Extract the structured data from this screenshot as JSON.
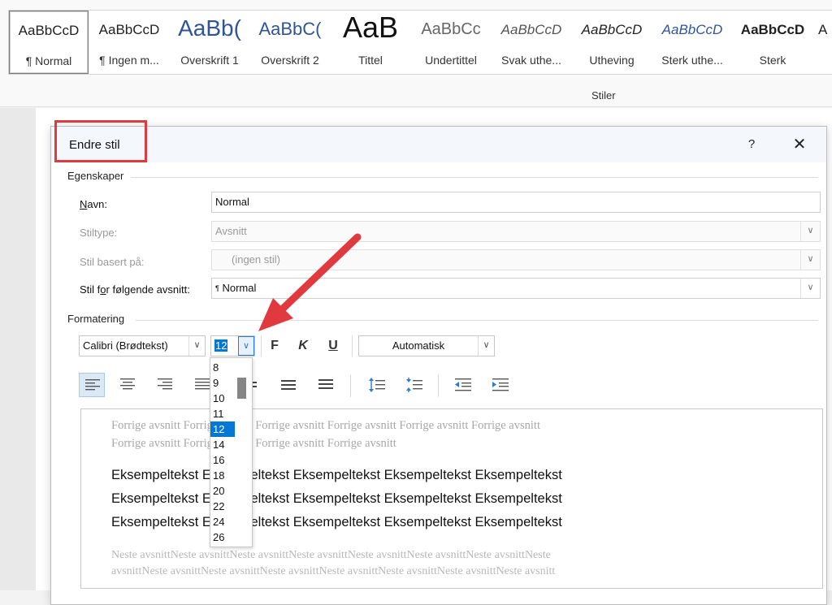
{
  "ribbon": {
    "styles": [
      {
        "preview": "AaBbCcD",
        "name": "¶ Normal",
        "selected": true
      },
      {
        "preview": "AaBbCcD",
        "name": "¶ Ingen m...",
        "selected": false
      },
      {
        "preview": "AaBb(",
        "name": "Overskrift 1",
        "selected": false
      },
      {
        "preview": "AaBbC(",
        "name": "Overskrift 2",
        "selected": false
      },
      {
        "preview": "AaB",
        "name": "Tittel",
        "selected": false
      },
      {
        "preview": "AaBbCc",
        "name": "Undertittel",
        "selected": false
      },
      {
        "preview": "AaBbCcD",
        "name": "Svak uthe...",
        "selected": false
      },
      {
        "preview": "AaBbCcD",
        "name": "Utheving",
        "selected": false
      },
      {
        "preview": "AaBbCcD",
        "name": "Sterk uthe...",
        "selected": false
      },
      {
        "preview": "AaBbCcD",
        "name": "Sterk",
        "selected": false
      },
      {
        "preview": "A",
        "name": "",
        "selected": false
      }
    ],
    "group_label": "Stiler"
  },
  "dialog": {
    "title": "Endre stil",
    "help": "?",
    "close": "✕",
    "properties": {
      "section": "Egenskaper",
      "name_label": "Navn:",
      "name_value": "Normal",
      "type_label": "Stiltype:",
      "type_value": "Avsnitt",
      "based_label": "Stil basert på:",
      "based_value": "(ingen stil)",
      "next_label": "Stil for følgende avsnitt:",
      "next_value": "Normal",
      "next_marker": "¶"
    },
    "formatting": {
      "section": "Formatering",
      "font": "Calibri (Brødtekst)",
      "size": "12",
      "bold": "F",
      "italic": "K",
      "underline": "U",
      "color": "Automatisk"
    },
    "size_list": [
      "8",
      "9",
      "10",
      "11",
      "12",
      "14",
      "16",
      "18",
      "20",
      "22",
      "24",
      "26"
    ],
    "size_selected": "12",
    "preview": {
      "prev1": "Forrige avsnitt Forrige avsnitt Forrige avsnitt Forrige avsnitt Forrige avsnitt Forrige avsnitt",
      "prev2": "Forrige avsnitt Forrige avsnitt Forrige avsnitt Forrige avsnitt",
      "sample1": "Eksempeltekst Eksempeltekst Eksempeltekst Eksempeltekst Eksempeltekst",
      "sample2": "Eksempeltekst Eksempeltekst Eksempeltekst Eksempeltekst Eksempeltekst",
      "sample3": "Eksempeltekst Eksempeltekst Eksempeltekst Eksempeltekst Eksempeltekst",
      "next1": "Neste avsnittNeste avsnittNeste avsnittNeste avsnittNeste avsnittNeste avsnittNeste avsnittNeste",
      "next2": "avsnittNeste avsnittNeste avsnittNeste avsnittNeste avsnittNeste avsnittNeste avsnittNeste avsnitt"
    }
  },
  "colors": {
    "highlight_red": "#e0393e",
    "selection_blue": "#0078d4"
  }
}
